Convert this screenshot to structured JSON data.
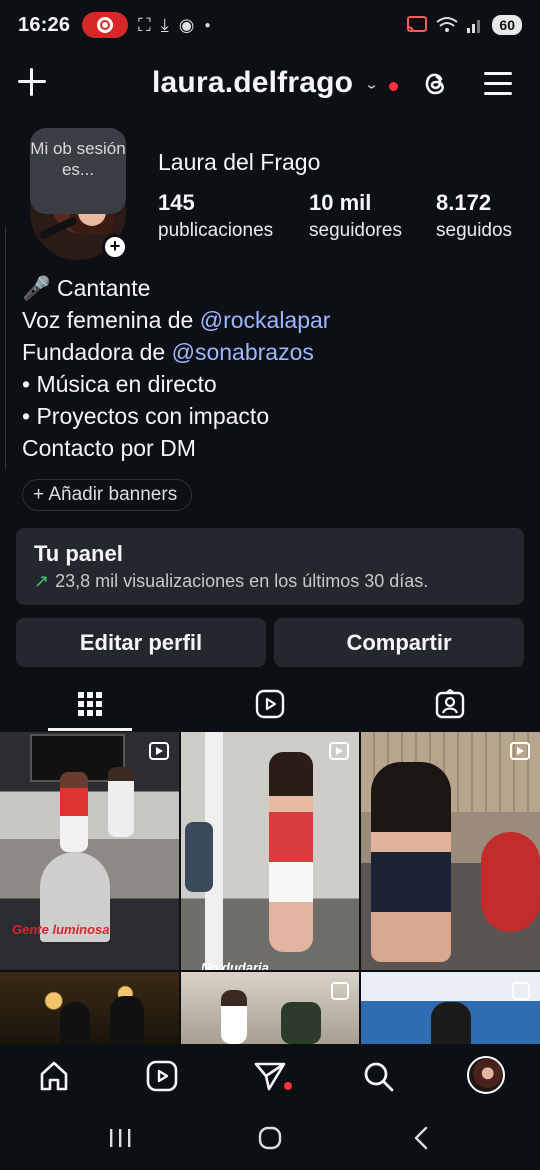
{
  "status": {
    "time": "16:26",
    "battery": "60"
  },
  "header": {
    "username": "laura.delfrago"
  },
  "profile": {
    "note": "Mi ob sesión es...",
    "full_name": "Laura del Frago",
    "stats": [
      {
        "value": "145",
        "label": "publicaciones"
      },
      {
        "value": "10 mil",
        "label": "seguidores"
      },
      {
        "value": "8.172",
        "label": "seguidos"
      }
    ],
    "bio": {
      "line1": "🎤 Cantante",
      "line2_prefix": "Voz femenina de ",
      "line2_link": "@rockalapar",
      "line3_prefix": "Fundadora de ",
      "line3_link": "@sonabrazos",
      "line4": "• Música en directo",
      "line5": "• Proyectos con impacto",
      "line6": "Contacto por DM"
    },
    "banners_label": "+ Añadir banners"
  },
  "panel": {
    "title": "Tu panel",
    "subtitle": "23,8 mil visualizaciones en los últimos 30 días."
  },
  "buttons": {
    "edit": "Editar perfil",
    "share": "Compartir"
  },
  "grid": {
    "captions": [
      "Gente luminosa",
      "No dudaria"
    ]
  },
  "icons": {
    "threads": "@",
    "posts_tab": "grid-icon",
    "reels_tab": "reels-icon",
    "tagged_tab": "tagged-icon"
  },
  "colors": {
    "background": "#0c0f14",
    "link": "#9fb7ff",
    "notification": "#ff3040",
    "panel": "#24272d",
    "trend_up": "#44c26a"
  }
}
